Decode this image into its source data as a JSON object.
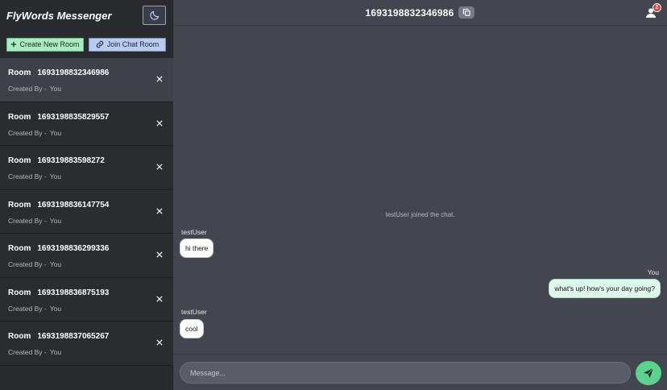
{
  "app": {
    "title": "FlyWords Messenger"
  },
  "sidebar": {
    "create_label": "Create New Room",
    "join_label": "Join Chat Room",
    "rooms": [
      {
        "label": "Room",
        "id": "1693198832346986",
        "created_by": "Created By -",
        "creator": "You",
        "active": true
      },
      {
        "label": "Room",
        "id": "1693198835829557",
        "created_by": "Created By -",
        "creator": "You"
      },
      {
        "label": "Room",
        "id": "169319883598272",
        "created_by": "Created By -",
        "creator": "You"
      },
      {
        "label": "Room",
        "id": "1693198836147754",
        "created_by": "Created By -",
        "creator": "You"
      },
      {
        "label": "Room",
        "id": "1693198836299336",
        "created_by": "Created By -",
        "creator": "You"
      },
      {
        "label": "Room",
        "id": "1693198836875193",
        "created_by": "Created By -",
        "creator": "You"
      },
      {
        "label": "Room",
        "id": "1693198837065267",
        "created_by": "Created By -",
        "creator": "You"
      }
    ]
  },
  "header": {
    "room_title": "1693198832346986",
    "notifications": "2"
  },
  "chat": {
    "system_message": "testUser joined the chat.",
    "messages": [
      {
        "sender": "testUser",
        "text": "hi there",
        "mine": false
      },
      {
        "sender": "You",
        "text": "what's up! how's your day going?",
        "mine": true
      },
      {
        "sender": "testUser",
        "text": "cool",
        "mine": false
      }
    ]
  },
  "composer": {
    "placeholder": "Message..."
  },
  "colors": {
    "sidebar_bg": "#2a2b2f",
    "chat_bg": "#43454f",
    "create_button": "#a9ecc1",
    "join_button": "#b9ccf0",
    "send_button": "#5ad38f",
    "badge": "#e63b3b"
  },
  "icons": {
    "theme": "moon-icon",
    "create": "plus-icon",
    "join": "link-icon",
    "close": "close-icon",
    "copy": "copy-icon",
    "user": "user-icon",
    "send": "send-icon"
  }
}
